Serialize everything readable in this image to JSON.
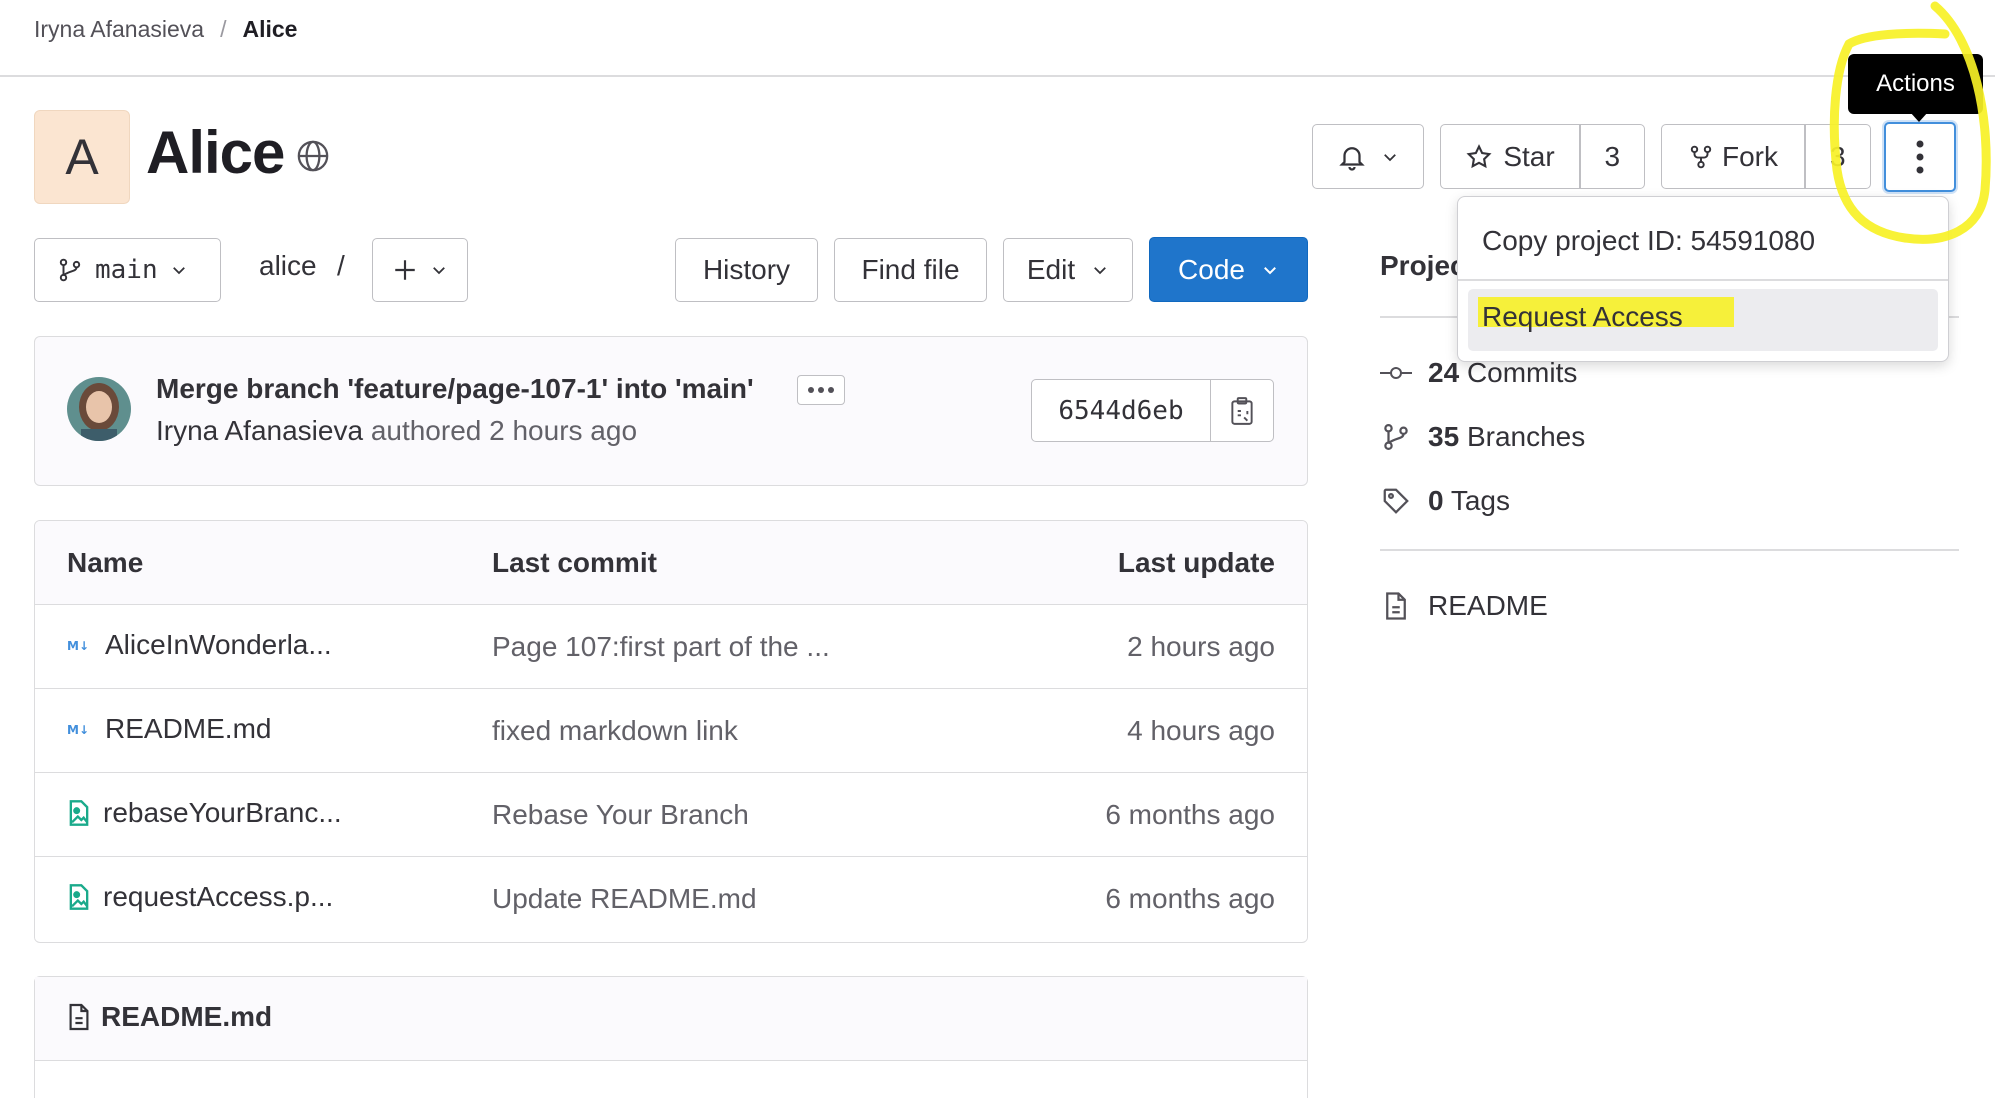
{
  "breadcrumb": {
    "owner": "Iryna Afanasieva",
    "separator": "/",
    "project": "Alice"
  },
  "project": {
    "avatar_letter": "A",
    "name": "Alice",
    "visibility_icon": "globe-icon"
  },
  "header_actions": {
    "notification_icon": "bell-icon",
    "star_label": "Star",
    "star_count": "3",
    "fork_label": "Fork",
    "fork_count": "3",
    "actions_tooltip": "Actions"
  },
  "actions_menu": {
    "copy_id": "Copy project ID: 54591080",
    "request_access": "Request Access"
  },
  "toolbar": {
    "branch": "main",
    "path": "alice",
    "path_separator": "/",
    "history": "History",
    "find_file": "Find file",
    "edit": "Edit",
    "code": "Code"
  },
  "last_commit": {
    "title": "Merge branch 'feature/page-107-1' into 'main'",
    "author": "Iryna Afanasieva",
    "meta": "authored 2 hours ago",
    "sha": "6544d6eb"
  },
  "file_table": {
    "headers": {
      "name": "Name",
      "last_commit": "Last commit",
      "last_update": "Last update"
    },
    "rows": [
      {
        "name": "AliceInWonderla...",
        "icon": "markdown-icon",
        "commit": "Page 107:first part of the ...",
        "updated": "2 hours ago"
      },
      {
        "name": "README.md",
        "icon": "markdown-icon",
        "commit": "fixed markdown link",
        "updated": "4 hours ago"
      },
      {
        "name": "rebaseYourBranc...",
        "icon": "image-file-icon",
        "commit": "Rebase Your Branch",
        "updated": "6 months ago"
      },
      {
        "name": "requestAccess.p...",
        "icon": "image-file-icon",
        "commit": "Update README.md",
        "updated": "6 months ago"
      }
    ]
  },
  "readme": {
    "title": "README.md"
  },
  "sidebar": {
    "title": "Projec",
    "commits_count": "24",
    "commits_label": "Commits",
    "branches_count": "35",
    "branches_label": "Branches",
    "tags_count": "0",
    "tags_label": "Tags",
    "readme_label": "README"
  },
  "colors": {
    "primary": "#1f75cb",
    "annotation": "#f7f126",
    "avatar_bg": "#fbe5d1"
  }
}
